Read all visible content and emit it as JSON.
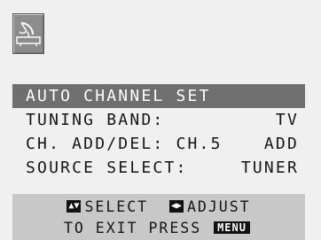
{
  "icon": "tv-tuner-antenna-icon",
  "colors": {
    "background": "#f0f0f0",
    "highlight": "#6f6f6f",
    "highlight_text": "#ffffff",
    "help_bar": "#c8c8c8",
    "text": "#151515"
  },
  "menu": {
    "items": [
      {
        "label": "AUTO CHANNEL SET",
        "value": "",
        "selected": true
      },
      {
        "label": "TUNING BAND:",
        "value": "TV",
        "selected": false
      },
      {
        "label": "CH. ADD/DEL: CH.5",
        "value": "ADD",
        "selected": false
      },
      {
        "label": "SOURCE SELECT:",
        "value": "TUNER",
        "selected": false
      }
    ]
  },
  "help": {
    "select_keys": "▲▼",
    "select_label": "SELECT",
    "adjust_keys": "◀▶",
    "adjust_label": "ADJUST",
    "exit_label": "TO EXIT PRESS",
    "menu_key": "MENU"
  }
}
